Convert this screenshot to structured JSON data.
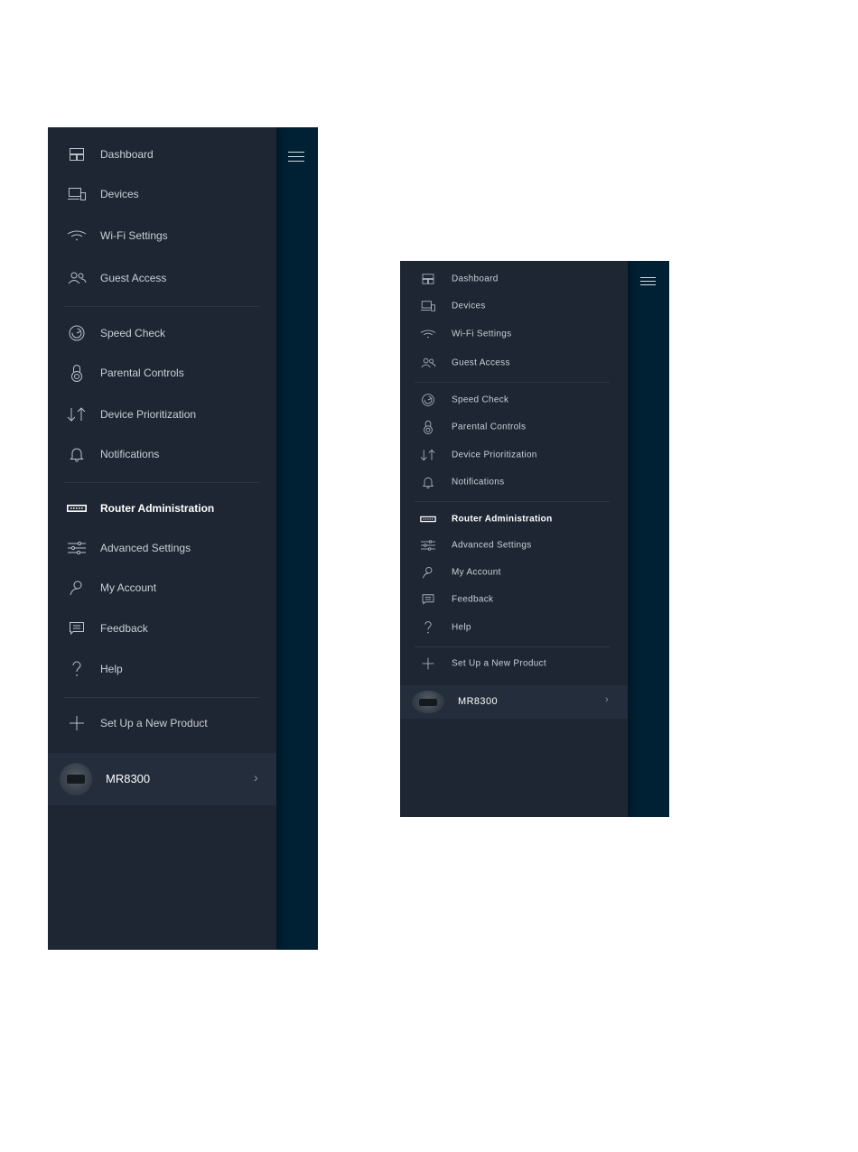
{
  "menu": {
    "items": [
      {
        "label": "Dashboard",
        "icon": "dashboard-icon"
      },
      {
        "label": "Devices",
        "icon": "devices-icon"
      },
      {
        "label": "Wi-Fi Settings",
        "icon": "wifi-icon"
      },
      {
        "label": "Guest Access",
        "icon": "guest-access-icon"
      },
      {
        "label": "Speed Check",
        "icon": "speedometer-icon"
      },
      {
        "label": "Parental Controls",
        "icon": "lock-icon"
      },
      {
        "label": "Device Prioritization",
        "icon": "priority-arrows-icon"
      },
      {
        "label": "Notifications",
        "icon": "bell-icon"
      },
      {
        "label": "Router Administration",
        "icon": "router-icon"
      },
      {
        "label": "Advanced Settings",
        "icon": "sliders-icon"
      },
      {
        "label": "My Account",
        "icon": "user-icon"
      },
      {
        "label": "Feedback",
        "icon": "chat-icon"
      },
      {
        "label": "Help",
        "icon": "question-icon"
      },
      {
        "label": "Set Up a New Product",
        "icon": "plus-icon"
      }
    ],
    "selected": "Router Administration"
  },
  "device": {
    "name": "MR8300",
    "chevron": "›"
  },
  "colors": {
    "drawer": "#1e2633",
    "background": "#002033",
    "text": "#c9cfd8",
    "selected_text": "#ffffff"
  }
}
